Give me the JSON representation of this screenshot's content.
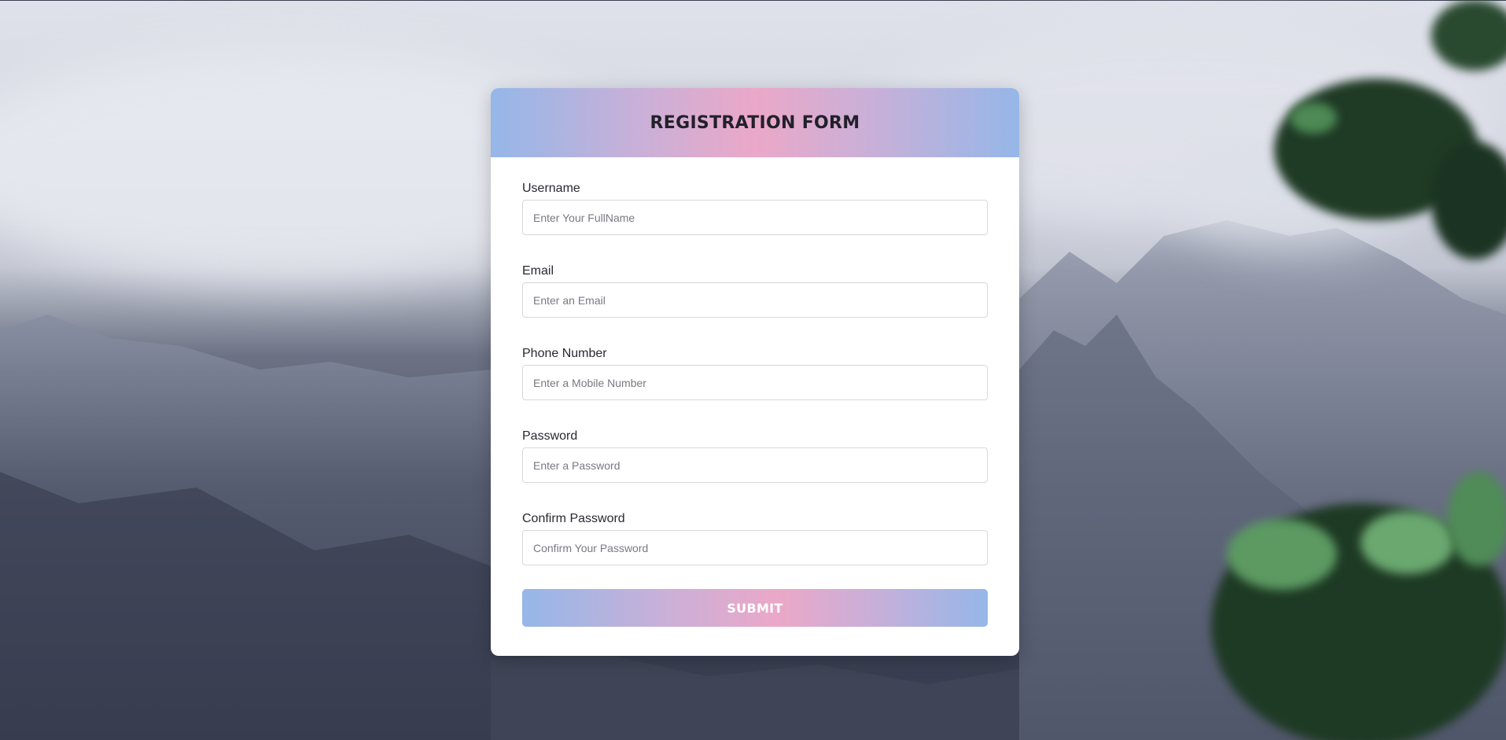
{
  "form": {
    "title": "REGISTRATION FORM",
    "fields": [
      {
        "label": "Username",
        "placeholder": "Enter Your FullName",
        "value": ""
      },
      {
        "label": "Email",
        "placeholder": "Enter an Email",
        "value": ""
      },
      {
        "label": "Phone Number",
        "placeholder": "Enter a Mobile Number",
        "value": ""
      },
      {
        "label": "Password",
        "placeholder": "Enter a Password",
        "value": ""
      },
      {
        "label": "Confirm Password",
        "placeholder": "Confirm Your Password",
        "value": ""
      }
    ],
    "submit_label": "SUBMIT"
  },
  "colors": {
    "header_gradient": [
      "#95b7e8",
      "#eba8c8",
      "#95b7e8"
    ],
    "card_background": "#ffffff",
    "title_color": "#22202a",
    "button_text": "#ffffff"
  }
}
